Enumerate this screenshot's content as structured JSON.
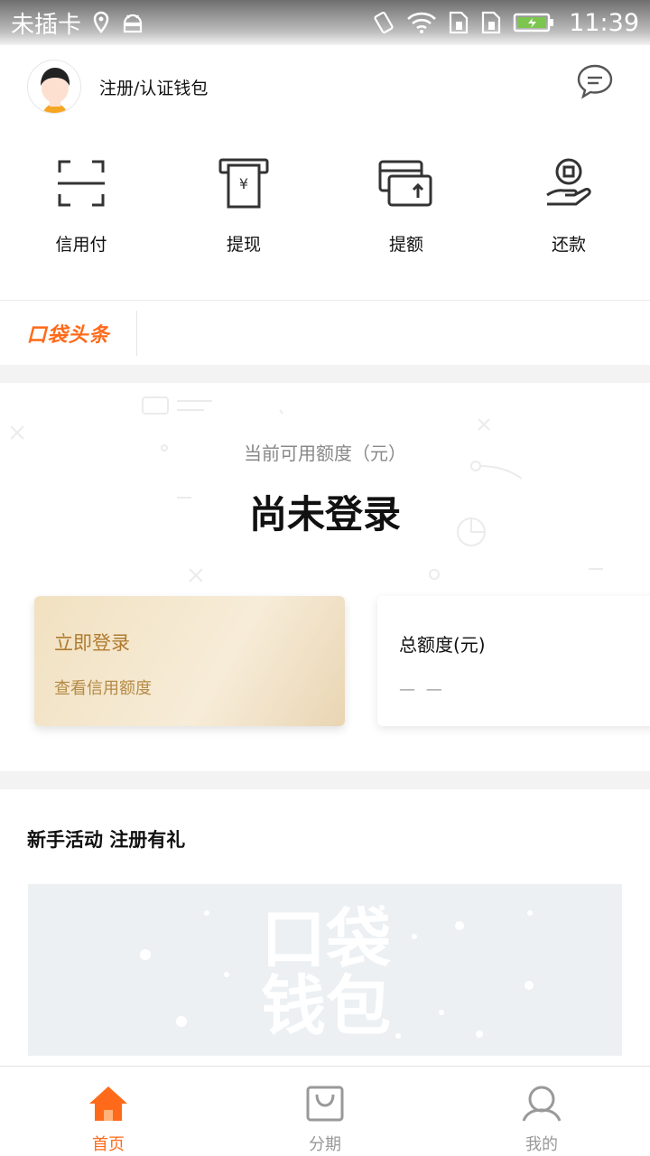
{
  "status_bar": {
    "carrier": "未插卡",
    "time": "11:39"
  },
  "header": {
    "title": "注册/认证钱包"
  },
  "actions": [
    {
      "label": "信用付",
      "icon": "scan-icon"
    },
    {
      "label": "提现",
      "icon": "atm-cash-icon"
    },
    {
      "label": "提额",
      "icon": "raise-limit-card-icon"
    },
    {
      "label": "还款",
      "icon": "repay-coin-hand-icon"
    }
  ],
  "news": {
    "logo_text": "口袋头条"
  },
  "credit": {
    "label": "当前可用额度（元）",
    "value": "尚未登录",
    "login_card": {
      "title": "立即登录",
      "subtitle": "查看信用额度"
    },
    "total_card": {
      "title": "总额度(元)",
      "value": "— —"
    }
  },
  "activity": {
    "title": "新手活动 注册有礼",
    "banner_watermark_line1": "口袋",
    "banner_watermark_line2": "钱包"
  },
  "tabbar": {
    "tabs": [
      {
        "label": "首页",
        "active": true
      },
      {
        "label": "分期",
        "active": false
      },
      {
        "label": "我的",
        "active": false
      }
    ]
  },
  "colors": {
    "accent": "#ff6a1a",
    "gold_text": "#b07b2e",
    "gap_background": "#f3f3f3",
    "banner_background": "#ecf0f3"
  }
}
